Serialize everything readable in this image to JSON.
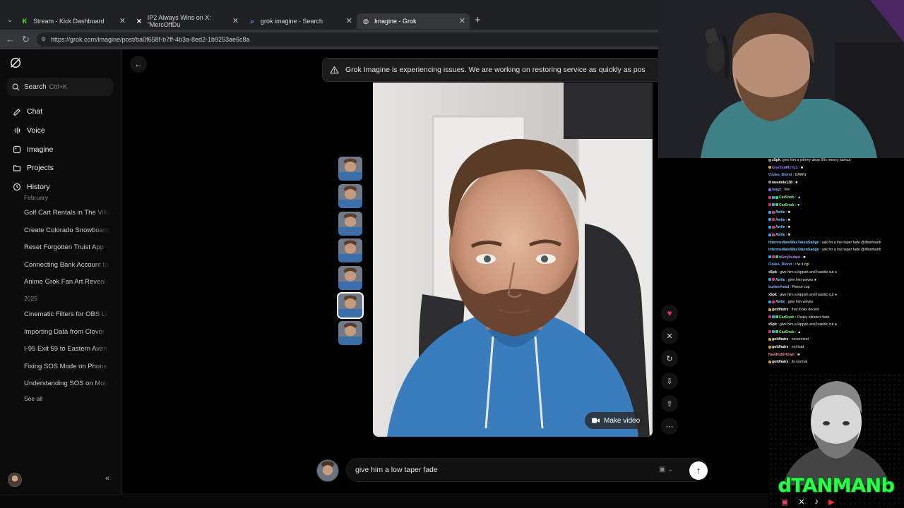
{
  "browser": {
    "tabs": [
      {
        "title": "Stream - Kick Dashboard",
        "icon": "kick-icon"
      },
      {
        "title": "IP2 Always Wins on X: \"MercOffDu",
        "icon": "x-icon"
      },
      {
        "title": "grok imagine - Search",
        "icon": "search-icon"
      },
      {
        "title": "Imagine - Grok",
        "icon": "grok-icon"
      }
    ],
    "active_tab": 3,
    "url": "https://grok.com/imagine/post/ba0f658f-b7ff-4b3a-8ed2-1b9253ae6c8a"
  },
  "sidebar": {
    "search_label": "Search",
    "search_shortcut": "Ctrl+K",
    "nav": [
      {
        "label": "Chat",
        "icon": "chat-icon"
      },
      {
        "label": "Voice",
        "icon": "voice-icon"
      },
      {
        "label": "Imagine",
        "icon": "imagine-icon"
      },
      {
        "label": "Projects",
        "icon": "projects-icon"
      },
      {
        "label": "History",
        "icon": "history-icon"
      }
    ],
    "history_groups": [
      {
        "heading": "February",
        "items": [
          "Golf Cart Rentals in The Villa",
          "Create Colorado Snowboard",
          "Reset Forgotten Truist App",
          "Connecting Bank Account to",
          "Anime Grok Fan Art Reveal"
        ]
      },
      {
        "heading": "2025",
        "items": [
          "Cinematic Filters for OBS Li",
          "Importing Data from Clover",
          "I-95 Exit 59 to Eastern Aven",
          "Fixing SOS Mode on Phone",
          "Understanding SOS on Mob"
        ]
      }
    ],
    "see_all": "See all"
  },
  "main": {
    "banner": "Grok Imagine is experiencing issues. We are working on restoring service as quickly as pos",
    "make_video": "Make video",
    "thumbnail_count": 7,
    "selected_thumbnail": 5,
    "prompt": "give him a low taper fade"
  },
  "chat": {
    "messages": [
      {
        "user": "x5pk",
        "color": "#ffffff",
        "text": ": give him a johnny depp 90s messy haircut",
        "badges": [
          "#8a8a8a"
        ]
      },
      {
        "user": "GrantedMeYou",
        "color": "#8f7bff",
        "text": " : ■",
        "badges": [
          "#c9a227"
        ]
      },
      {
        "user": "Osaka_Blond",
        "color": "#6ca0ff",
        "text": " : DAWG",
        "badges": []
      },
      {
        "user": "weemile138",
        "color": "#ffffff",
        "text": " : ■",
        "badges": [
          "#8a8a8a"
        ]
      },
      {
        "user": "teagc",
        "color": "#8fa8ff",
        "text": " : fire",
        "badges": [
          "#5a7aff"
        ]
      },
      {
        "user": "CarSnob",
        "color": "#7dff8a",
        "text": " : ▲",
        "badges": [
          "#e0325a",
          "#2ea8ff",
          "#3fd45a"
        ]
      },
      {
        "user": "CarSnob",
        "color": "#7dff8a",
        "text": " : ♥",
        "badges": [
          "#e0325a",
          "#2ea8ff",
          "#3fd45a"
        ]
      },
      {
        "user": "Awile",
        "color": "#7dc8ff",
        "text": " : ■",
        "badges": [
          "#2ea8ff",
          "#e0325a"
        ]
      },
      {
        "user": "Awile",
        "color": "#7dc8ff",
        "text": " : ■",
        "badges": [
          "#2ea8ff",
          "#e0325a"
        ]
      },
      {
        "user": "Awile",
        "color": "#7dc8ff",
        "text": " : ■",
        "badges": [
          "#2ea8ff",
          "#e0325a"
        ]
      },
      {
        "user": "Awile",
        "color": "#7dc8ff",
        "text": " : ■",
        "badges": [
          "#2ea8ff",
          "#e0325a"
        ]
      },
      {
        "user": "IntermediateWasTakenSadge",
        "color": "#7dc8ff",
        "text": " : ask for a low taper fade @dtanmanb",
        "badges": []
      },
      {
        "user": "IntermediateWasTakenSadge",
        "color": "#7dc8ff",
        "text": " : ask for a low taper fade @dtanmanb",
        "badges": []
      },
      {
        "user": "hikeyitsdani",
        "color": "#b98cff",
        "text": " : ■",
        "badges": [
          "#2ea8ff",
          "#e0325a",
          "#3fd45a"
        ]
      },
      {
        "user": "Osaka_Blond",
        "color": "#6ca0ff",
        "text": " : i fw it ngl",
        "badges": []
      },
      {
        "user": "x5pk",
        "color": "#ffffff",
        "text": " : give him a kippah and hasidic cut ●",
        "badges": []
      },
      {
        "user": "Awile",
        "color": "#7dc8ff",
        "text": " : give him waves ●",
        "badges": [
          "#2ea8ff",
          "#e0325a"
        ]
      },
      {
        "user": "bunkerhead",
        "color": "#8fa8ff",
        "text": " : Reece cup",
        "badges": []
      },
      {
        "user": "x5pk",
        "color": "#ffffff",
        "text": " : give him a kippah and hasidic cut ●",
        "badges": []
      },
      {
        "user": "Awile",
        "color": "#7dc8ff",
        "text": " : give him waves",
        "badges": [
          "#2ea8ff",
          "#e0325a"
        ]
      },
      {
        "user": "goldhairs",
        "color": "#ffffff",
        "text": " : that looks decent",
        "badges": [
          "#c9a227"
        ]
      },
      {
        "user": "CarSnob",
        "color": "#7dff8a",
        "text": " : Peaky blinders fade",
        "badges": [
          "#e0325a",
          "#2ea8ff",
          "#3fd45a"
        ]
      },
      {
        "user": "x5pk",
        "color": "#ffffff",
        "text": " : give him a kippah and hasidic cut ●",
        "badges": []
      },
      {
        "user": "CarSnob",
        "color": "#7dff8a",
        "text": " : ▲",
        "badges": [
          "#e0325a",
          "#2ea8ff",
          "#3fd45a"
        ]
      },
      {
        "user": "goldhairs",
        "color": "#ffffff",
        "text": " : nevermind",
        "badges": [
          "#c9a227"
        ]
      },
      {
        "user": "goldhairs",
        "color": "#ffffff",
        "text": " : not bad",
        "badges": [
          "#c9a227"
        ]
      },
      {
        "user": "NewKidInTown",
        "color": "#ff8fa0",
        "text": " : ■",
        "badges": []
      },
      {
        "user": "goldhairs",
        "color": "#ffffff",
        "text": " : its normal",
        "badges": [
          "#c9a227"
        ]
      }
    ]
  },
  "overlay": {
    "brand_name": "dTANMANb"
  },
  "colors": {
    "app_bg": "#000000",
    "sidebar_bg": "#0b0b0b",
    "accent_heart": "#e0325a",
    "brand_green": "#2aff4a"
  }
}
